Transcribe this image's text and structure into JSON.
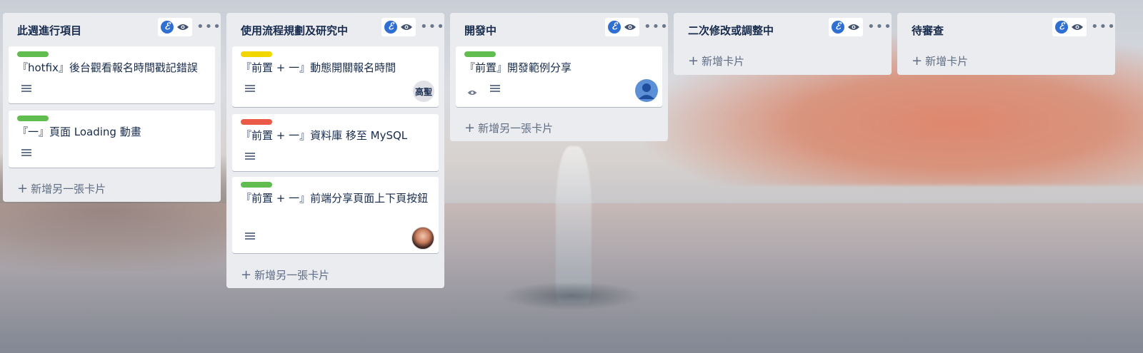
{
  "colors": {
    "label_green": "#61bd4f",
    "label_yellow": "#f2d600",
    "label_red": "#eb5a46",
    "list_bg": "#ebecf0",
    "avatar_blue": "#5b8fd6"
  },
  "icons": {
    "list_badge": "e-icon",
    "list_watch": "eye-icon",
    "list_menu": "more-icon",
    "card_description": "description-icon",
    "card_watch": "eye-icon"
  },
  "lists": [
    {
      "title": "此週進行項目",
      "cards": [
        {
          "title": "『hotfix』後台觀看報名時間戳記錯誤",
          "label": "green"
        },
        {
          "title": "『一』頁面 Loading 動畫",
          "label": "green"
        }
      ],
      "add_label": "新增另一張卡片"
    },
    {
      "title": "使用流程規劃及研究中",
      "cards": [
        {
          "title": "『前置 + 一』動態開關報名時間",
          "label": "yellow",
          "member": "高聖"
        },
        {
          "title": "『前置 + 一』資料庫 移至 MySQL",
          "label": "red"
        },
        {
          "title": "『前置 + 一』前端分享頁面上下頁按鈕",
          "label": "green",
          "member": "photo"
        }
      ],
      "add_label": "新增另一張卡片"
    },
    {
      "title": "開發中",
      "cards": [
        {
          "title": "『前置』開發範例分享",
          "label": "green",
          "member": "default-avatar"
        }
      ],
      "add_label": "新增另一張卡片"
    },
    {
      "title": "二次修改或調整中",
      "cards": [],
      "add_label": "新增卡片"
    },
    {
      "title": "待審查",
      "cards": [],
      "add_label": "新增卡片"
    }
  ]
}
